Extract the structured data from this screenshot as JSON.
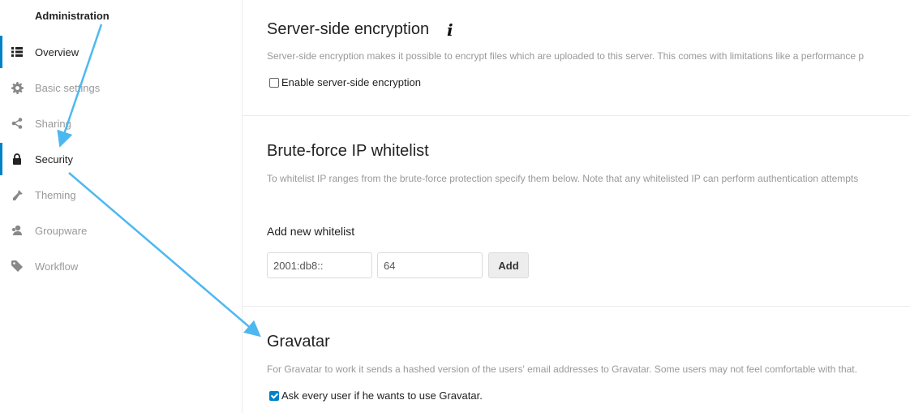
{
  "sidebar": {
    "heading": "Administration",
    "items": [
      {
        "label": "Overview",
        "icon": "list-icon"
      },
      {
        "label": "Basic settings",
        "icon": "gear-icon"
      },
      {
        "label": "Sharing",
        "icon": "share-icon"
      },
      {
        "label": "Security",
        "icon": "lock-icon"
      },
      {
        "label": "Theming",
        "icon": "paintbrush-icon"
      },
      {
        "label": "Groupware",
        "icon": "user-icon"
      },
      {
        "label": "Workflow",
        "icon": "tag-icon"
      }
    ]
  },
  "encryption": {
    "title": "Server-side encryption",
    "info_icon": "i",
    "description": "Server-side encryption makes it possible to encrypt files which are uploaded to this server. This comes with limitations like a performance p",
    "checkbox_label": "Enable server-side encryption",
    "checked": false
  },
  "bruteforce": {
    "title": "Brute-force IP whitelist",
    "description": "To whitelist IP ranges from the brute-force protection specify them below. Note that any whitelisted IP can perform authentication attempts",
    "subtitle": "Add new whitelist",
    "ip_value": "2001:db8::",
    "mask_value": "64",
    "add_label": "Add"
  },
  "gravatar": {
    "title": "Gravatar",
    "description": "For Gravatar to work it sends a hashed version of the users' email addresses to Gravatar. Some users may not feel comfortable with that.",
    "checkbox_label": "Ask every user if he wants to use Gravatar.",
    "checked": true
  },
  "colors": {
    "accent": "#0082c9",
    "annotation_arrow": "#4db8f0"
  }
}
